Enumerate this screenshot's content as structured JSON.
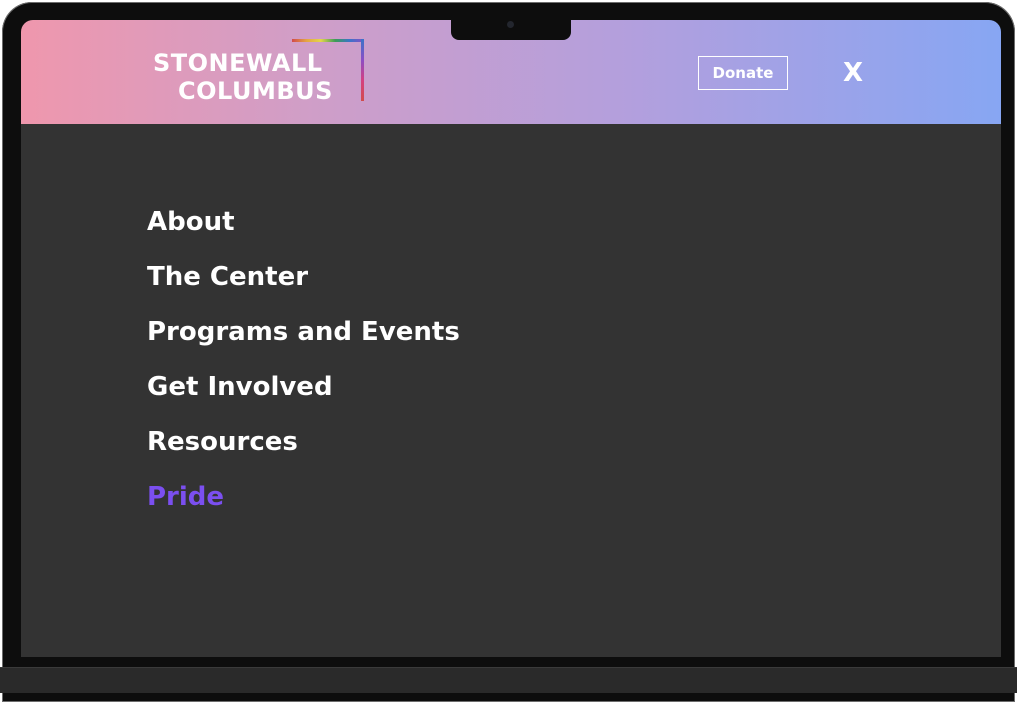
{
  "header": {
    "logo": {
      "line1": "STONEWALL",
      "line2": "COLUMBUS"
    },
    "donate_label": "Donate",
    "close_label": "X"
  },
  "nav": {
    "items": [
      {
        "label": "About"
      },
      {
        "label": "The Center"
      },
      {
        "label": "Programs and Events"
      },
      {
        "label": "Get Involved"
      },
      {
        "label": "Resources"
      },
      {
        "label": "Pride",
        "active": true
      }
    ]
  },
  "colors": {
    "menu_background": "#333333",
    "active_item": "#7b4ff0",
    "header_gradient": [
      "#ef97ad",
      "#b39fdd",
      "#87a6f3"
    ]
  },
  "icons": {
    "close": "close-icon"
  }
}
